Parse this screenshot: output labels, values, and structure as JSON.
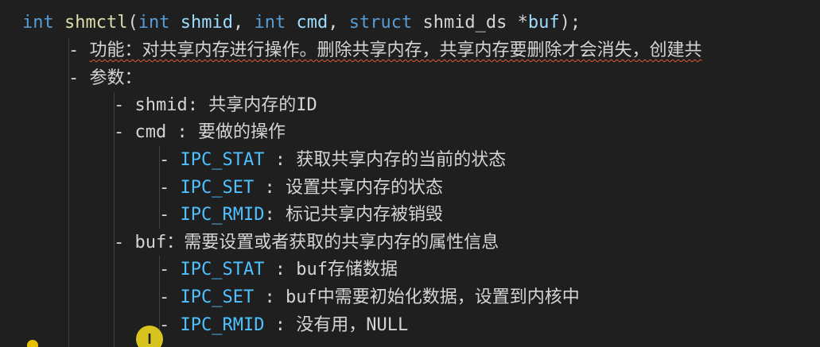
{
  "code": {
    "signature": {
      "type1": "int",
      "name": "shmctl",
      "open": "(",
      "type2": "int",
      "param1": "shmid",
      "comma1": ", ",
      "type3": "int",
      "param2": "cmd",
      "comma2": ", ",
      "kw_struct": "struct",
      "struct_type": "shmid_ds",
      "ptr": " *",
      "param3": "buf",
      "close": ");"
    },
    "lines": [
      {
        "dash": "- ",
        "text": "功能：对共享内存进行操作。删除共享内存，共享内存要删除才会消失，创建共"
      },
      {
        "dash": "- ",
        "text": "参数："
      },
      {
        "dash": "- ",
        "text": "shmid: 共享内存的ID"
      },
      {
        "dash": "- ",
        "text": "cmd : 要做的操作"
      },
      {
        "dash": "- ",
        "const": "IPC_STAT",
        "text": " : 获取共享内存的当前的状态"
      },
      {
        "dash": "- ",
        "const": "IPC_SET",
        "text": " : 设置共享内存的状态"
      },
      {
        "dash": "- ",
        "const": "IPC_RMID",
        "text": ": 标记共享内存被销毁"
      },
      {
        "dash": "- ",
        "text": "buf：需要设置或者获取的共享内存的属性信息"
      },
      {
        "dash": "- ",
        "const": "IPC_STAT",
        "text": " : buf存储数据"
      },
      {
        "dash": "- ",
        "const": "IPC_SET",
        "text": " : buf中需要初始化数据，设置到内核中"
      },
      {
        "dash": "- ",
        "const": "IPC_RMID",
        "text": " : 没有用，NULL"
      }
    ]
  },
  "cursor": {
    "glyph": "I"
  },
  "colors": {
    "background": "#1f1f1f",
    "keyword": "#569cd6",
    "function": "#dcdcaa",
    "parameter": "#9cdcfe",
    "constant": "#4fc1ff",
    "text": "#d4d4d4",
    "squiggle": "#e05a2f",
    "cursor_highlight": "#d8c41e"
  }
}
